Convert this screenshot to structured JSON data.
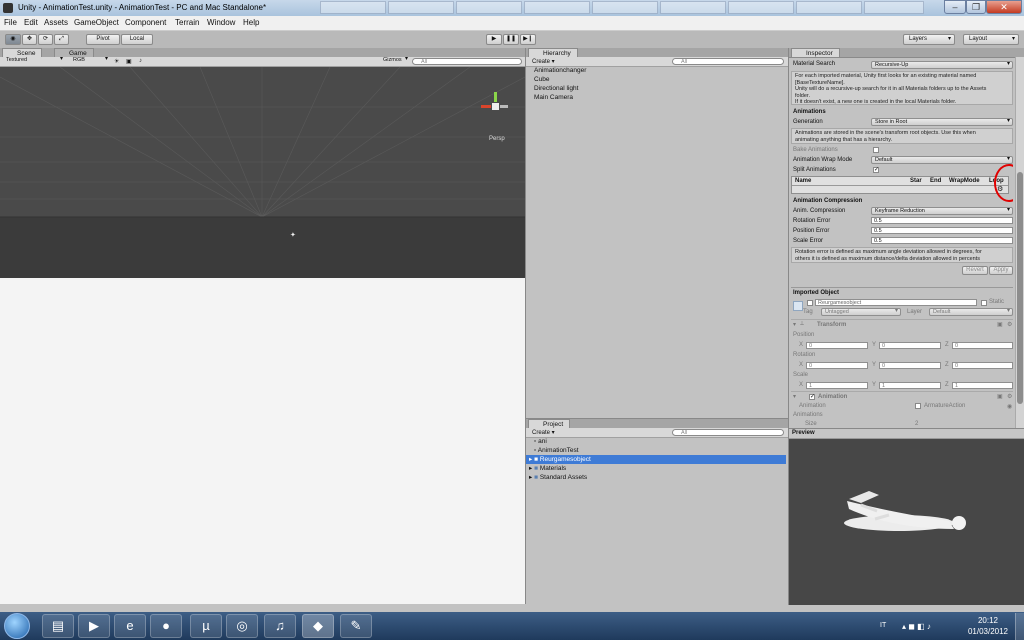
{
  "window": {
    "title": "Unity - AnimationTest.unity - AnimationTest - PC and Mac Standalone*",
    "background_tabs": [
      "",
      "",
      "",
      "",
      "",
      "",
      "",
      "",
      "",
      ""
    ]
  },
  "menubar": [
    "File",
    "Edit",
    "Assets",
    "GameObject",
    "Component",
    "Terrain",
    "Window",
    "Help"
  ],
  "toolbar": {
    "pivot": "Pivot",
    "local": "Local",
    "layers": "Layers",
    "layout": "Layout"
  },
  "scene": {
    "tabs": [
      "Scene",
      "Game"
    ],
    "render_mode": "Textured",
    "color_mode": "RGB",
    "gizmos": "Gizmos",
    "search_placeholder": "All",
    "persp": "Persp",
    "colors": {
      "sky": "#4a4a4a",
      "ground": "#f4f4f4"
    }
  },
  "hierarchy": {
    "tab": "Hierarchy",
    "create": "Create",
    "search_placeholder": "All",
    "items": [
      "Animationchanger",
      "Cube",
      "Directional light",
      "Main Camera"
    ]
  },
  "project": {
    "tab": "Project",
    "create": "Create",
    "search_placeholder": "All",
    "items": [
      "ani",
      "AnimationTest",
      "Reurgamesobject",
      "Materials",
      "Standard Assets"
    ]
  },
  "inspector": {
    "tab": "Inspector",
    "material_search_label": "Material Search",
    "material_search_value": "Recursive-Up",
    "material_help": [
      "For each imported material, Unity first looks for an existing material named",
      "[BaseTextureName].",
      "Unity will do a recursive-up search for it in all Materials folders up to the Assets",
      "folder.",
      "If it doesn't exist, a new one is created in the local Materials folder."
    ],
    "animations_header": "Animations",
    "generation_label": "Generation",
    "generation_value": "Store in Root",
    "animations_help": [
      "Animations are stored in the scene's transform root objects. Use this when",
      "animating anything that has a hierarchy."
    ],
    "bake_label": "Bake Animations",
    "wrap_label": "Animation Wrap Mode",
    "wrap_value": "Default",
    "split_label": "Split Animations",
    "split_columns": [
      "Name",
      "Star",
      "End",
      "WrapMode",
      "Loop"
    ],
    "compression_header": "Animation Compression",
    "anim_compression_label": "Anim. Compression",
    "anim_compression_value": "Keyframe Reduction",
    "rotation_error_label": "Rotation Error",
    "rotation_error_value": "0.5",
    "position_error_label": "Position Error",
    "position_error_value": "0.5",
    "scale_error_label": "Scale Error",
    "scale_error_value": "0.5",
    "compression_help": [
      "Rotation error is defined as maximum angle deviation allowed in degrees, for",
      "others it is defined as maximum distance/delta deviation allowed in percents"
    ],
    "revert": "Revert",
    "apply": "Apply",
    "imported_header": "Imported Object",
    "object_name": "Reurgamesobject",
    "static_label": "Static",
    "tag_label": "Tag",
    "tag_value": "Untagged",
    "layer_label": "Layer",
    "layer_value": "Default",
    "transform_header": "Transform",
    "position_label": "Position",
    "rotation_label": "Rotation",
    "scale_label": "Scale",
    "axes": [
      "X",
      "Y",
      "Z"
    ],
    "position_values": [
      "0",
      "0",
      "0"
    ],
    "rotation_values": [
      "0",
      "0",
      "0"
    ],
    "scale_values": [
      "1",
      "1",
      "1"
    ],
    "animation_header": "Animation",
    "animation_label": "Animation",
    "animation_value": "ArmatureAction",
    "animations_label": "Animations",
    "size_label": "Size",
    "size_value": "2"
  },
  "preview": {
    "header": "Preview"
  },
  "taskbar": {
    "language": "IT",
    "time": "20:12",
    "date": "01/03/2012",
    "icons": [
      "start-orb-icon",
      "folder-icon",
      "media-player-icon",
      "ie-icon",
      "firefox-icon",
      "utorrent-icon",
      "blender-icon",
      "itunes-icon",
      "unity-icon",
      "gimp-icon"
    ]
  },
  "annotation": {
    "color": "#e00000"
  }
}
